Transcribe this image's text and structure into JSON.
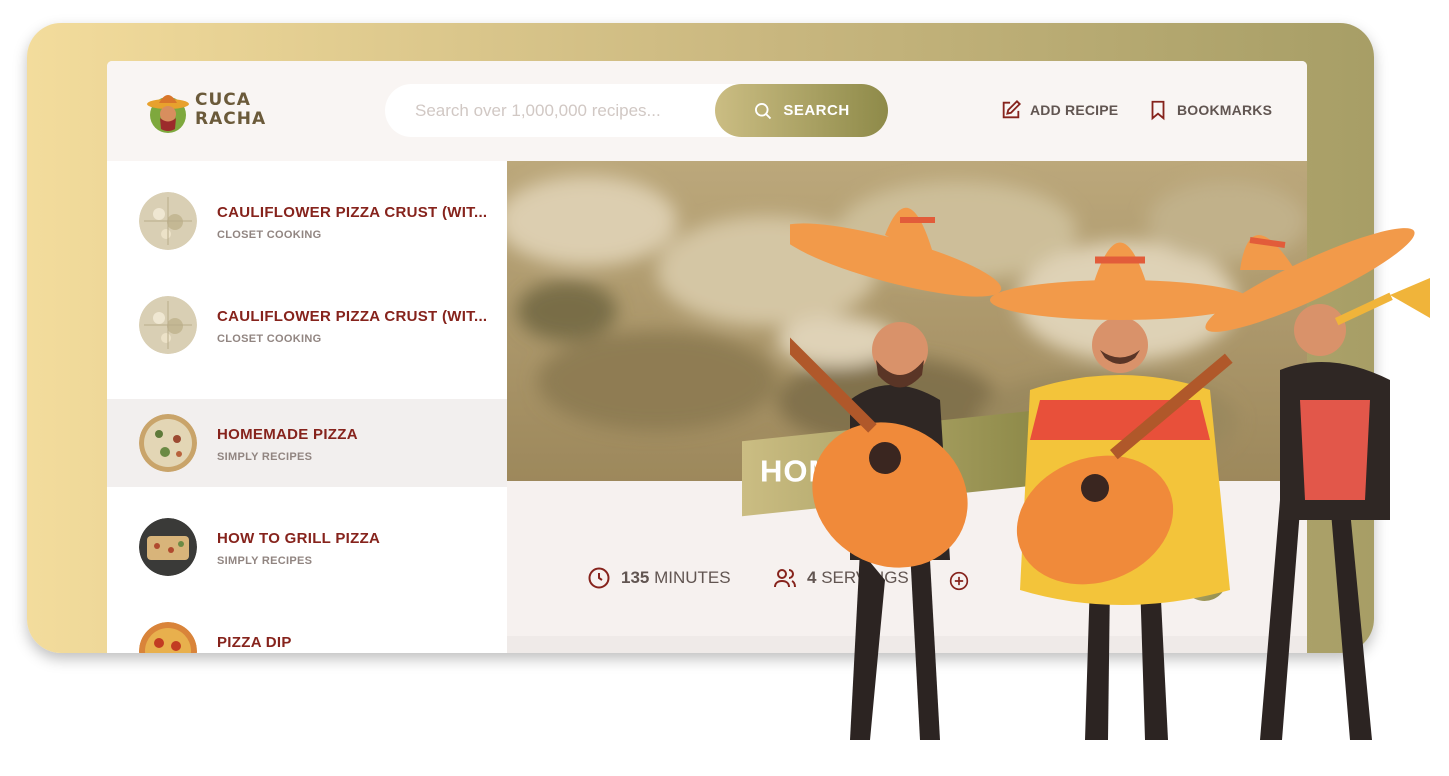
{
  "app": {
    "logo_line1": "CUCA",
    "logo_line2": "RACHA",
    "colors": {
      "accent_start": "#cbbd83",
      "accent_end": "#8e8a49",
      "title": "#86231c",
      "text": "#615551"
    }
  },
  "header": {
    "search_placeholder": "Search over 1,000,000 recipes...",
    "search_button": "SEARCH",
    "add_recipe": "ADD RECIPE",
    "bookmarks": "BOOKMARKS"
  },
  "results": [
    {
      "title": "CAULIFLOWER PIZZA CRUST (WIT...",
      "publisher": "CLOSET COOKING",
      "active": false
    },
    {
      "title": "CAULIFLOWER PIZZA CRUST (WIT...",
      "publisher": "CLOSET COOKING",
      "active": false
    },
    {
      "title": "HOMEMADE PIZZA",
      "publisher": "SIMPLY RECIPES",
      "active": true
    },
    {
      "title": "HOW TO GRILL PIZZA",
      "publisher": "SIMPLY RECIPES",
      "active": false
    },
    {
      "title": "PIZZA DIP",
      "publisher": "",
      "active": false
    }
  ],
  "recipe": {
    "title_visible": "HOM",
    "minutes": "135",
    "minutes_label": "MINUTES",
    "servings": "4",
    "servings_label": "SERVINGS"
  },
  "icons": {
    "search": "search-icon",
    "add": "edit-icon",
    "bookmark": "bookmark-icon",
    "clock": "clock-icon",
    "users": "users-icon",
    "plus": "plus-circle-icon"
  }
}
